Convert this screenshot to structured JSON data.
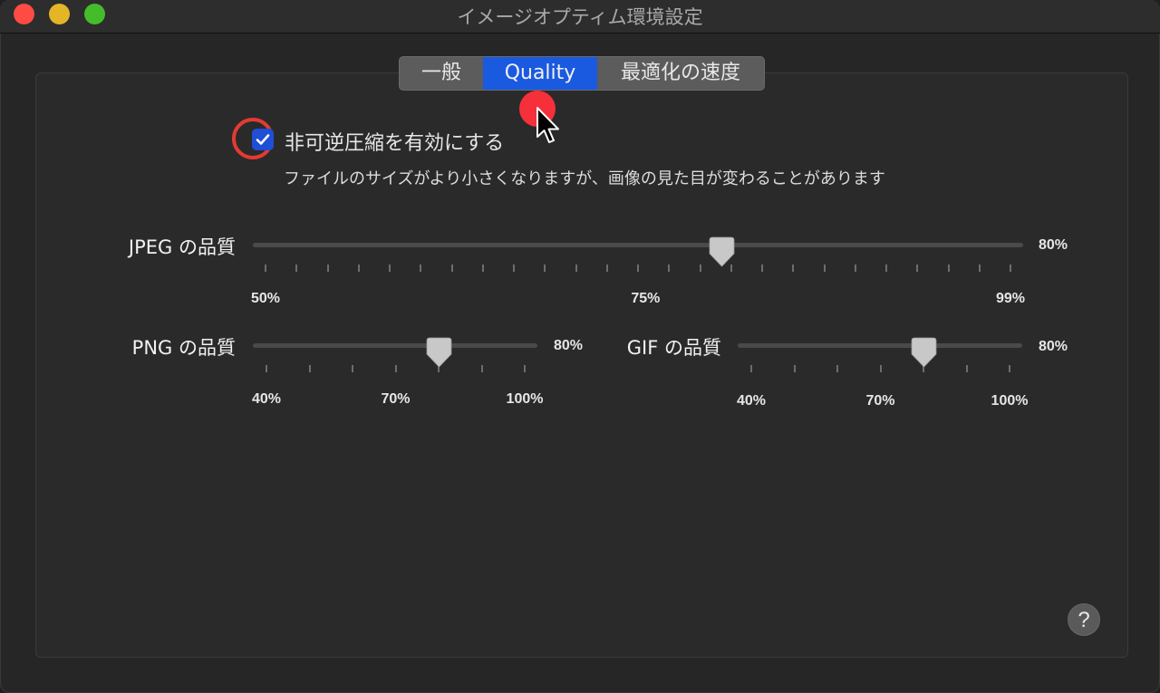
{
  "window": {
    "title": "イメージオプティム環境設定",
    "traffic_lights": [
      "close",
      "minimize",
      "maximize"
    ]
  },
  "tabs": [
    {
      "id": "general",
      "label": "一般",
      "selected": false
    },
    {
      "id": "quality",
      "label": "Quality",
      "selected": true
    },
    {
      "id": "speed",
      "label": "最適化の速度",
      "selected": false
    }
  ],
  "lossy": {
    "checked": true,
    "label": "非可逆圧縮を有効にする",
    "description": "ファイルのサイズがより小さくなりますが、画像の見た目が変わることがあります"
  },
  "sliders": {
    "jpeg": {
      "label": "JPEG の品質",
      "min": 50,
      "max": 99,
      "value": 80,
      "value_label": "80%",
      "tick_count": 25,
      "tick_labels": [
        "50%",
        "75%",
        "99%"
      ],
      "tick_label_values": [
        50,
        75,
        99
      ]
    },
    "png": {
      "label": "PNG の品質",
      "min": 40,
      "max": 100,
      "value": 80,
      "value_label": "80%",
      "tick_count": 7,
      "tick_labels": [
        "40%",
        "70%",
        "100%"
      ],
      "tick_label_values": [
        40,
        70,
        100
      ]
    },
    "gif": {
      "label": "GIF の品質",
      "min": 40,
      "max": 100,
      "value": 80,
      "value_label": "80%",
      "tick_count": 7,
      "tick_labels": [
        "40%",
        "70%",
        "100%"
      ],
      "tick_label_values": [
        40,
        70,
        100
      ]
    }
  },
  "help": {
    "label": "?"
  },
  "colors": {
    "accent": "#1a5ae0",
    "checkbox": "#1f4fd6",
    "highlight_ring": "#e23b34",
    "click_indicator": "#f6303a"
  }
}
